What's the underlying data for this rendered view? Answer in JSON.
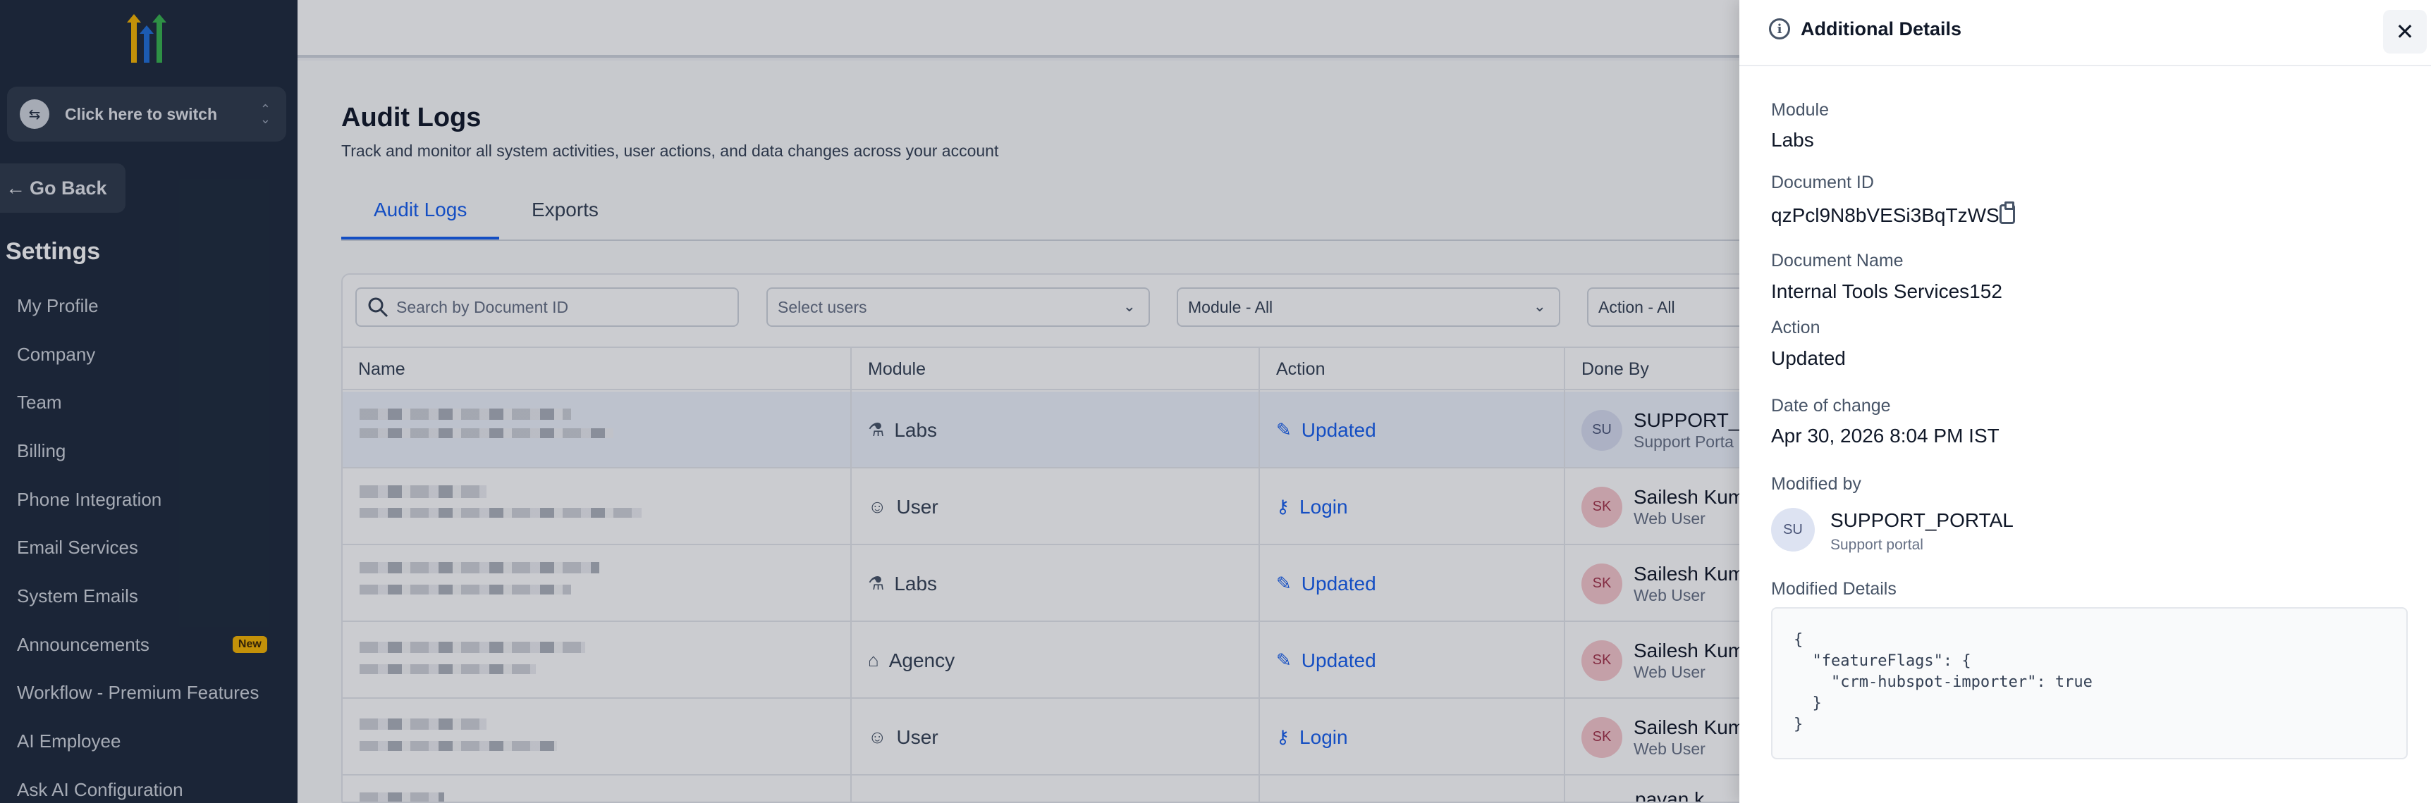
{
  "sidebar": {
    "switcher_label": "Click here to switch",
    "go_back": "Go Back",
    "settings_title": "Settings",
    "items": [
      {
        "label": "My Profile"
      },
      {
        "label": "Company"
      },
      {
        "label": "Team"
      },
      {
        "label": "Billing"
      },
      {
        "label": "Phone Integration"
      },
      {
        "label": "Email Services"
      },
      {
        "label": "System Emails"
      },
      {
        "label": "Announcements",
        "badge": "New"
      },
      {
        "label": "Workflow - Premium Features"
      },
      {
        "label": "AI Employee"
      },
      {
        "label": "Ask AI Configuration"
      }
    ]
  },
  "page": {
    "title": "Audit Logs",
    "subtitle": "Track and monitor all system activities, user actions, and data changes across your account",
    "tabs": [
      {
        "label": "Audit Logs",
        "active": true
      },
      {
        "label": "Exports",
        "active": false
      }
    ]
  },
  "filters": {
    "search_placeholder": "Search by Document ID",
    "users_placeholder": "Select users",
    "module_value": "Module - All",
    "action_value": "Action - All"
  },
  "table": {
    "headers": [
      "Name",
      "Module",
      "Action",
      "Done By"
    ],
    "rows": [
      {
        "module": "Labs",
        "module_icon": "flask-icon",
        "action": "Updated",
        "action_icon": "edit-icon",
        "initials": "SU",
        "done_by": "SUPPORT_P",
        "done_by_sub": "Support Porta",
        "selected": true
      },
      {
        "module": "User",
        "module_icon": "user-icon",
        "action": "Login",
        "action_icon": "key-icon",
        "initials": "SK",
        "done_by": "Sailesh Kum",
        "done_by_sub": "Web User",
        "selected": false
      },
      {
        "module": "Labs",
        "module_icon": "flask-icon",
        "action": "Updated",
        "action_icon": "edit-icon",
        "initials": "SK",
        "done_by": "Sailesh Kum",
        "done_by_sub": "Web User",
        "selected": false
      },
      {
        "module": "Agency",
        "module_icon": "bank-icon",
        "action": "Updated",
        "action_icon": "edit-icon",
        "initials": "SK",
        "done_by": "Sailesh Kum",
        "done_by_sub": "Web User",
        "selected": false
      },
      {
        "module": "User",
        "module_icon": "user-icon",
        "action": "Login",
        "action_icon": "key-icon",
        "initials": "SK",
        "done_by": "Sailesh Kum",
        "done_by_sub": "Web User",
        "selected": false
      }
    ],
    "partial_row_done_by": "pavan k"
  },
  "details": {
    "title": "Additional Details",
    "module_label": "Module",
    "module_value": "Labs",
    "document_id_label": "Document ID",
    "document_id_value": "qzPcl9N8bVESi3BqTzWS",
    "document_name_label": "Document Name",
    "document_name_value": "Internal Tools Services152",
    "action_label": "Action",
    "action_value": "Updated",
    "date_label": "Date of change",
    "date_value": "Apr 30, 2026 8:04 PM IST",
    "modified_by_label": "Modified by",
    "modified_by_initials": "SU",
    "modified_by_name": "SUPPORT_PORTAL",
    "modified_by_sub": "Support portal",
    "modified_details_label": "Modified Details",
    "modified_details_code": "{\n  \"featureFlags\": {\n    \"crm-hubspot-importer\": true\n  }\n}"
  },
  "colors": {
    "sidebar_bg": "#1e2a3b",
    "accent": "#155eef",
    "badge": "#f5b400"
  }
}
